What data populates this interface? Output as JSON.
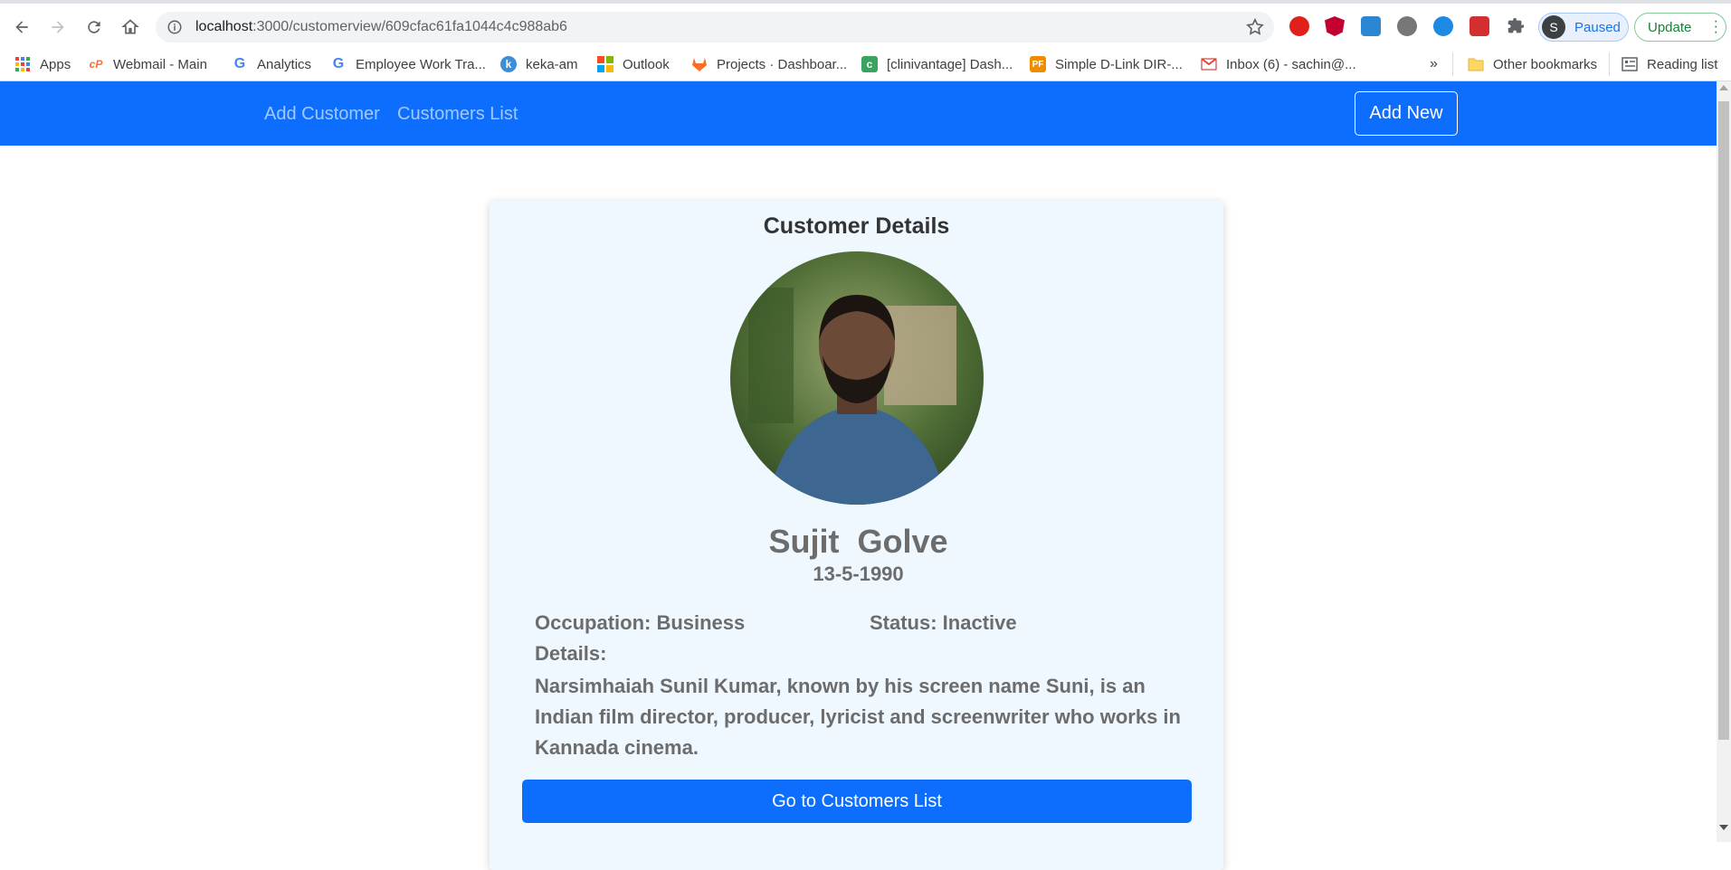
{
  "browser": {
    "url_host": "localhost",
    "url_path": ":3000/customerview/609cfac61fa1044c4c988ab6",
    "profile_initial": "S",
    "profile_status": "Paused",
    "update_label": "Update",
    "bookmarks": [
      {
        "label": "Apps",
        "icon": "apps-grid-icon"
      },
      {
        "label": "Webmail - Main",
        "icon": "cpanel-icon"
      },
      {
        "label": "Analytics",
        "icon": "google-icon"
      },
      {
        "label": "Employee Work Tra...",
        "icon": "google-icon"
      },
      {
        "label": "keka-am",
        "icon": "keka-icon"
      },
      {
        "label": "Outlook",
        "icon": "microsoft-icon"
      },
      {
        "label": "Projects · Dashboar...",
        "icon": "gitlab-icon"
      },
      {
        "label": "[clinivantage] Dash...",
        "icon": "clinivantage-icon"
      },
      {
        "label": "Simple D-Link DIR-...",
        "icon": "pf-icon"
      },
      {
        "label": "Inbox (6) - sachin@...",
        "icon": "gmail-icon"
      }
    ],
    "more_bookmarks": "»",
    "other_bookmarks": "Other bookmarks",
    "reading_list": "Reading list"
  },
  "navbar": {
    "links": [
      "Add Customer",
      "Customers List"
    ],
    "add_new_label": "Add New",
    "color": "#0d6efd"
  },
  "card": {
    "title": "Customer Details",
    "first_name": "Sujit",
    "last_name": "Golve",
    "dob": "13-5-1990",
    "occupation_label": "Occupation: Business",
    "status_label": "Status: Inactive",
    "details_label": "Details:",
    "details_text": "Narsimhaiah Sunil Kumar, known by his screen name Suni, is an Indian film director, producer, lyricist and screenwriter who works in Kannada cinema.",
    "goto_button": "Go to Customers List",
    "background": "#f0f8ff"
  }
}
